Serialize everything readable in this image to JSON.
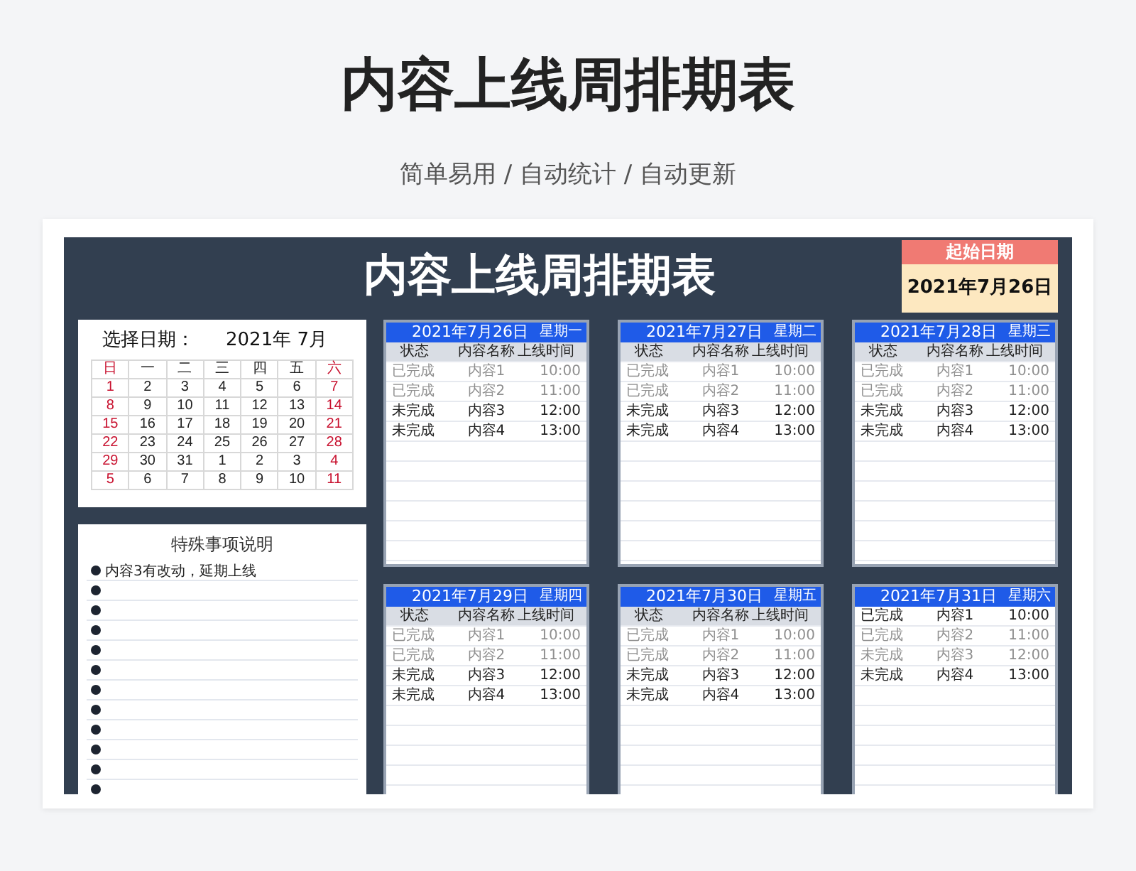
{
  "title": "内容上线周排期表",
  "subtitle": "简单易用 / 自动统计 / 自动更新",
  "sheet": {
    "title": "内容上线周排期表",
    "start_date": {
      "label": "起始日期",
      "value": "2021年7月26日"
    },
    "calendar": {
      "label": "选择日期：",
      "month": "2021年  7月",
      "weekdays": [
        "日",
        "一",
        "二",
        "三",
        "四",
        "五",
        "六"
      ],
      "weeks": [
        [
          "1",
          "2",
          "3",
          "4",
          "5",
          "6",
          "7"
        ],
        [
          "8",
          "9",
          "10",
          "11",
          "12",
          "13",
          "14"
        ],
        [
          "15",
          "16",
          "17",
          "18",
          "19",
          "20",
          "21"
        ],
        [
          "22",
          "23",
          "24",
          "25",
          "26",
          "27",
          "28"
        ],
        [
          "29",
          "30",
          "31",
          "1",
          "2",
          "3",
          "4"
        ],
        [
          "5",
          "6",
          "7",
          "8",
          "9",
          "10",
          "11"
        ]
      ]
    },
    "notes": {
      "title": "特殊事项说明",
      "items": [
        {
          "kind": "text",
          "text": "内容3有改动，延期上线"
        },
        {
          "kind": "blank"
        },
        {
          "kind": "blank"
        },
        {
          "kind": "blank"
        },
        {
          "kind": "blank"
        },
        {
          "kind": "blank"
        },
        {
          "kind": "blank"
        },
        {
          "kind": "blank"
        },
        {
          "kind": "blank"
        },
        {
          "kind": "blank"
        },
        {
          "kind": "blank"
        },
        {
          "kind": "blank"
        }
      ]
    },
    "days": [
      {
        "date": "2021年7月26日",
        "weekday": "星期一",
        "columns": [
          "状态",
          "内容名称",
          "上线时间"
        ],
        "rows": [
          {
            "status": "已完成",
            "name": "内容1",
            "time": "10:00",
            "struck": true
          },
          {
            "status": "已完成",
            "name": "内容2",
            "time": "11:00",
            "struck": true
          },
          {
            "status": "未完成",
            "name": "内容3",
            "time": "12:00",
            "struck": false
          },
          {
            "status": "未完成",
            "name": "内容4",
            "time": "13:00",
            "struck": false
          }
        ]
      },
      {
        "date": "2021年7月27日",
        "weekday": "星期二",
        "columns": [
          "状态",
          "内容名称",
          "上线时间"
        ],
        "rows": [
          {
            "status": "已完成",
            "name": "内容1",
            "time": "10:00",
            "struck": true
          },
          {
            "status": "已完成",
            "name": "内容2",
            "time": "11:00",
            "struck": true
          },
          {
            "status": "未完成",
            "name": "内容3",
            "time": "12:00",
            "struck": false
          },
          {
            "status": "未完成",
            "name": "内容4",
            "time": "13:00",
            "struck": false
          }
        ]
      },
      {
        "date": "2021年7月28日",
        "weekday": "星期三",
        "columns": [
          "状态",
          "内容名称",
          "上线时间"
        ],
        "rows": [
          {
            "status": "已完成",
            "name": "内容1",
            "time": "10:00",
            "struck": true
          },
          {
            "status": "已完成",
            "name": "内容2",
            "time": "11:00",
            "struck": true
          },
          {
            "status": "未完成",
            "name": "内容3",
            "time": "12:00",
            "struck": false
          },
          {
            "status": "未完成",
            "name": "内容4",
            "time": "13:00",
            "struck": false
          }
        ]
      },
      {
        "date": "2021年7月29日",
        "weekday": "星期四",
        "columns": [
          "状态",
          "内容名称",
          "上线时间"
        ],
        "rows": [
          {
            "status": "已完成",
            "name": "内容1",
            "time": "10:00",
            "struck": true
          },
          {
            "status": "已完成",
            "name": "内容2",
            "time": "11:00",
            "struck": true
          },
          {
            "status": "未完成",
            "name": "内容3",
            "time": "12:00",
            "struck": false
          },
          {
            "status": "未完成",
            "name": "内容4",
            "time": "13:00",
            "struck": false
          }
        ]
      },
      {
        "date": "2021年7月30日",
        "weekday": "星期五",
        "columns": [
          "状态",
          "内容名称",
          "上线时间"
        ],
        "rows": [
          {
            "status": "已完成",
            "name": "内容1",
            "time": "10:00",
            "struck": true
          },
          {
            "status": "已完成",
            "name": "内容2",
            "time": "11:00",
            "struck": true
          },
          {
            "status": "未完成",
            "name": "内容3",
            "time": "12:00",
            "struck": false
          },
          {
            "status": "未完成",
            "name": "内容4",
            "time": "13:00",
            "struck": false
          }
        ]
      },
      {
        "date": "2021年7月31日",
        "weekday": "星期六",
        "rows": [
          {
            "status": "已完成",
            "name": "内容1",
            "time": "10:00",
            "struck": false
          },
          {
            "status": "已完成",
            "name": "内容2",
            "time": "11:00",
            "struck": true
          },
          {
            "status": "未完成",
            "name": "内容3",
            "time": "12:00",
            "struck": true
          },
          {
            "status": "未完成",
            "name": "内容4",
            "time": "13:00",
            "struck": false
          }
        ]
      }
    ]
  }
}
